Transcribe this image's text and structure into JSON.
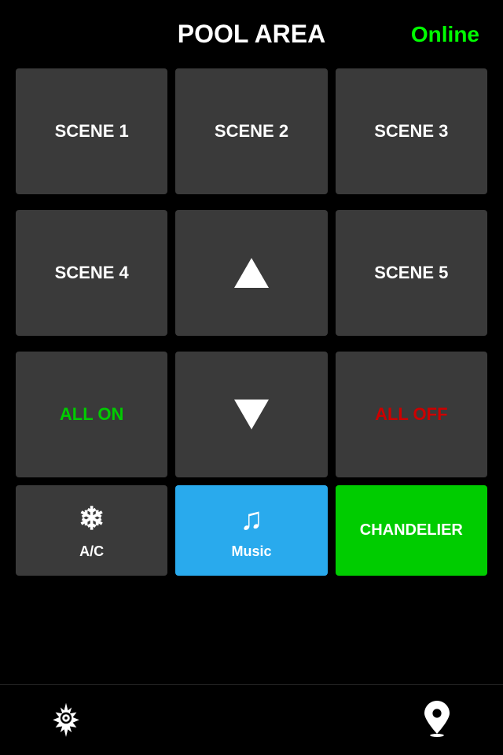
{
  "header": {
    "title": "POOL AREA",
    "status": "Online"
  },
  "grid": {
    "rows": [
      [
        {
          "id": "scene1",
          "label": "SCENE 1",
          "type": "text",
          "color": "white"
        },
        {
          "id": "scene2",
          "label": "SCENE 2",
          "type": "text",
          "color": "white"
        },
        {
          "id": "scene3",
          "label": "SCENE 3",
          "type": "text",
          "color": "white"
        }
      ],
      [
        {
          "id": "scene4",
          "label": "SCENE 4",
          "type": "text",
          "color": "white"
        },
        {
          "id": "up",
          "label": "",
          "type": "arrow-up",
          "color": "white"
        },
        {
          "id": "scene5",
          "label": "SCENE 5",
          "type": "text",
          "color": "white"
        }
      ],
      [
        {
          "id": "allon",
          "label": "ALL ON",
          "type": "text",
          "color": "green"
        },
        {
          "id": "down",
          "label": "",
          "type": "arrow-down",
          "color": "white"
        },
        {
          "id": "alloff",
          "label": "ALL OFF",
          "type": "text",
          "color": "red"
        }
      ]
    ]
  },
  "bottom_row": [
    {
      "id": "ac",
      "label": "A/C",
      "type": "snowflake",
      "bg": "dark"
    },
    {
      "id": "music",
      "label": "Music",
      "type": "music",
      "bg": "blue"
    },
    {
      "id": "chandelier",
      "label": "CHANDELIER",
      "type": "text",
      "bg": "green"
    }
  ],
  "footer": {
    "settings_label": "settings",
    "location_label": "location"
  }
}
